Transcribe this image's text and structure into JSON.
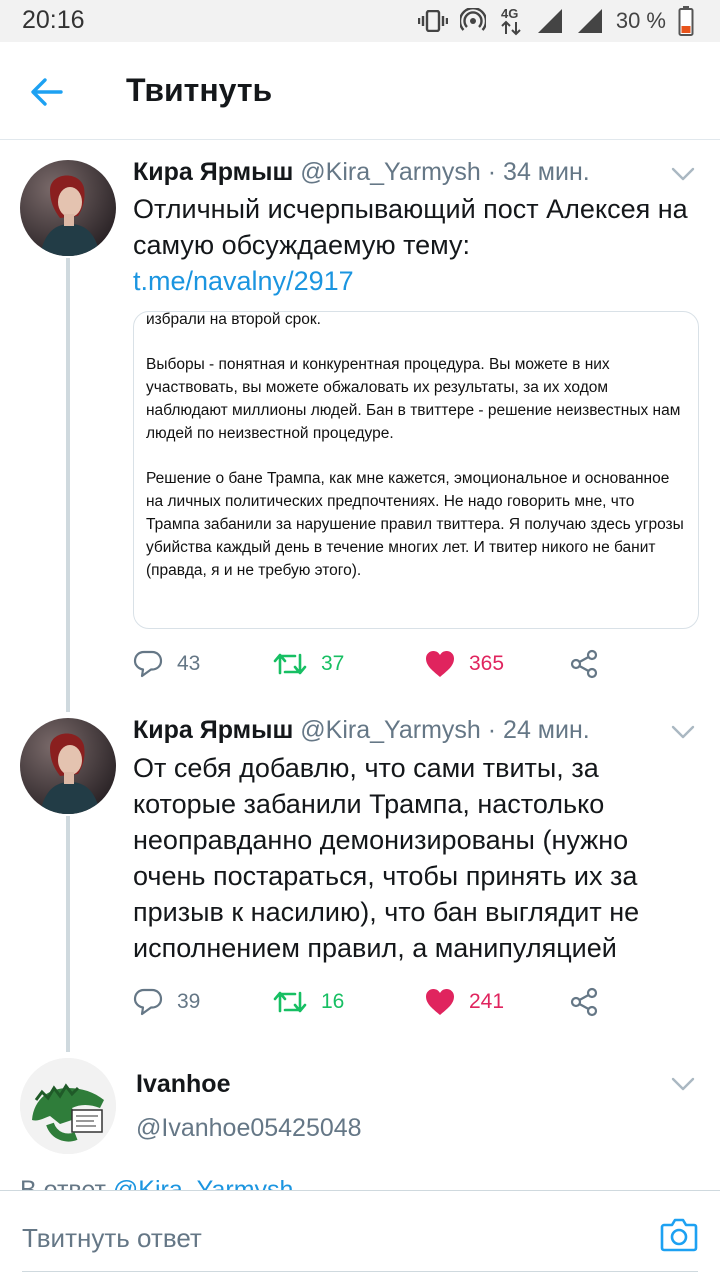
{
  "status_bar": {
    "time": "20:16",
    "network": "4G",
    "battery": "30 %",
    "icons": [
      "vibrate-icon",
      "hotspot-icon",
      "network-4g-icon",
      "signal-icon",
      "signal-icon",
      "battery-icon"
    ]
  },
  "header": {
    "title": "Твитнуть",
    "back_icon": "arrow-left-icon"
  },
  "tweets": [
    {
      "name": "Кира Ярмыш",
      "handle": "@Kira_Yarmysh",
      "time": "· 34 мин.",
      "text_before_link": "Отличный исчерпывающий пост Алексея на самую обсуждаемую тему: ",
      "link": "t.me/navalny/2917",
      "image_paragraphs": [
        "избрали на второй срок.",
        "Выборы - понятная и конкурентная процедура. Вы можете в них участвовать, вы можете обжаловать их результаты, за их ходом наблюдают миллионы людей. Бан в твиттере - решение неизвестных нам людей по неизвестной процедуре.",
        "Решение о бане Трампа, как мне кажется, эмоциональное и основанное на личных политических предпочтениях. Не надо говорить мне, что Трампа забанили за нарушение правил твиттера. Я получаю здесь угрозы убийства каждый день в течение многих лет. И твитер никого не банит (правда, я и не требую этого)."
      ],
      "replies": "43",
      "retweets": "37",
      "likes": "365"
    },
    {
      "name": "Кира Ярмыш",
      "handle": "@Kira_Yarmysh",
      "time": "· 24 мин.",
      "text": "От себя добавлю, что сами твиты, за которые забанили Трампа, настолько неоправданно демонизированы (нужно очень постараться, чтобы принять их за призыв к насилию), что бан выглядит не исполнением правил, а манипуляцией",
      "replies": "39",
      "retweets": "16",
      "likes": "241"
    },
    {
      "name": "Ivanhoe",
      "handle": "@Ivanhoe05425048",
      "reply_prefix": "В ответ ",
      "reply_to": "@Kira_Yarmysh"
    }
  ],
  "compose": {
    "placeholder": "Твитнуть ответ",
    "camera_icon": "camera-icon"
  },
  "colors": {
    "link": "#1b95e0",
    "retweet": "#17bf63",
    "like": "#e0245e",
    "secondary": "#657786"
  }
}
